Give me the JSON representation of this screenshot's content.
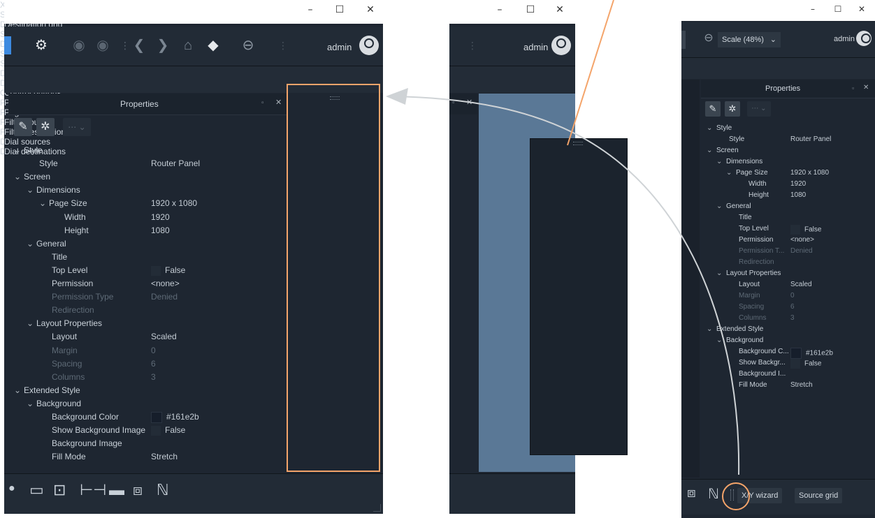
{
  "window_controls": {
    "minimize": "–",
    "maximize": "☐",
    "close": "✕"
  },
  "user": {
    "name": "admin"
  },
  "toolbar_right": {
    "zoom_label": "Scale (48%)"
  },
  "properties": {
    "title": "Properties",
    "rows": [
      {
        "indent": 0,
        "chevron": true,
        "label": "Style",
        "value": "",
        "dim": false
      },
      {
        "indent": 1,
        "chevron": false,
        "label": "Style",
        "value": "Router Panel",
        "dim": false
      },
      {
        "indent": 0,
        "chevron": true,
        "label": "Screen",
        "value": "",
        "dim": false
      },
      {
        "indent": 1,
        "chevron": true,
        "label": "Dimensions",
        "value": "",
        "dim": false
      },
      {
        "indent": 2,
        "chevron": true,
        "label": "Page Size",
        "value": "1920 x 1080",
        "dim": false
      },
      {
        "indent": 3,
        "chevron": false,
        "label": "Width",
        "value": "1920",
        "dim": false
      },
      {
        "indent": 3,
        "chevron": false,
        "label": "Height",
        "value": "1080",
        "dim": false
      },
      {
        "indent": 1,
        "chevron": true,
        "label": "General",
        "value": "",
        "dim": false
      },
      {
        "indent": 2,
        "chevron": false,
        "label": "Title",
        "value": "",
        "dim": false
      },
      {
        "indent": 2,
        "chevron": false,
        "label": "Top Level",
        "value": "False",
        "dim": false,
        "check": true
      },
      {
        "indent": 2,
        "chevron": false,
        "label": "Permission",
        "value": "<none>",
        "dim": false
      },
      {
        "indent": 2,
        "chevron": false,
        "label": "Permission Type",
        "value": "Denied",
        "dim": true
      },
      {
        "indent": 2,
        "chevron": false,
        "label": "Redirection",
        "value": "",
        "dim": true
      },
      {
        "indent": 1,
        "chevron": true,
        "label": "Layout Properties",
        "value": "",
        "dim": false
      },
      {
        "indent": 2,
        "chevron": false,
        "label": "Layout",
        "value": "Scaled",
        "dim": false
      },
      {
        "indent": 2,
        "chevron": false,
        "label": "Margin",
        "value": "0",
        "dim": true
      },
      {
        "indent": 2,
        "chevron": false,
        "label": "Spacing",
        "value": "6",
        "dim": true
      },
      {
        "indent": 2,
        "chevron": false,
        "label": "Columns",
        "value": "3",
        "dim": true
      },
      {
        "indent": 0,
        "chevron": true,
        "label": "Extended Style",
        "value": "",
        "dim": false
      },
      {
        "indent": 1,
        "chevron": true,
        "label": "Background",
        "value": "",
        "dim": false
      },
      {
        "indent": 2,
        "chevron": false,
        "label": "Background Color",
        "value": "#161e2b",
        "dim": false,
        "swatch": true
      },
      {
        "indent": 2,
        "chevron": false,
        "label": "Show Background Image",
        "value": "False",
        "dim": false,
        "check": true
      },
      {
        "indent": 2,
        "chevron": false,
        "label": "Background Image",
        "value": "",
        "dim": false
      },
      {
        "indent": 2,
        "chevron": false,
        "label": "Fill Mode",
        "value": "Stretch",
        "dim": false
      }
    ],
    "small_labels": {
      "Permission Type": "Permission T...",
      "Background Color": "Background C...",
      "Show Background Image": "Show Backgr...",
      "Background Image": "Background I..."
    }
  },
  "wizard_buttons": [
    "X/Y wizard",
    "Source grid",
    "Destination grid",
    "Source button",
    "Destination button",
    "Source level",
    "Source level grid",
    "Destination level",
    "Destination level grid",
    "Control buttons",
    "Page sources",
    "Page destinations",
    "Filter sources",
    "Filter destinations",
    "Dial sources",
    "Dial destinations"
  ],
  "docked_buttons": [
    "X/Y wizard",
    "Source grid"
  ],
  "icons": {
    "toolbar_left": [
      "layout-icon",
      "gear-icon",
      "camera-icon",
      "camera-icon",
      "grip-icon",
      "back-icon",
      "forward-icon",
      "home-icon",
      "tag-icon",
      "zoom-out-icon"
    ],
    "bottom_left": [
      "dot-icon",
      "slider-icon",
      "box-icon",
      "range-icon",
      "line-icon",
      "speaker-icon",
      "wave-icon"
    ]
  },
  "colors": {
    "highlight_orange": "#f4a46a",
    "canvas_blue": "#5a7896",
    "panel_bg": "#1e2631"
  }
}
